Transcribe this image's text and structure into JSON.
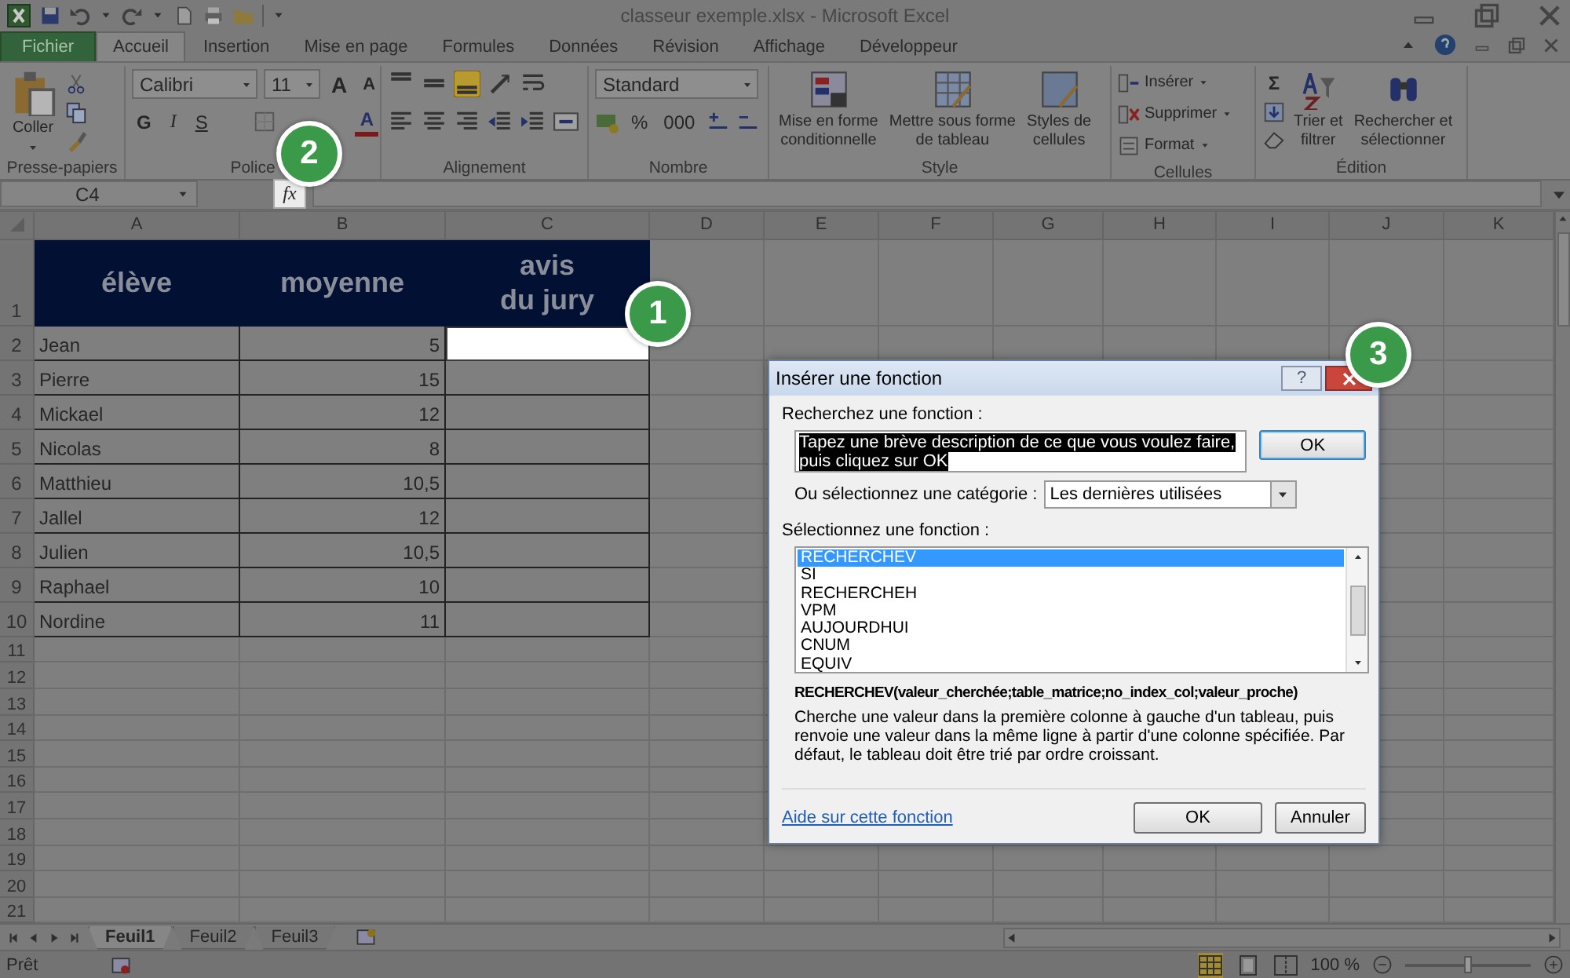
{
  "window": {
    "title": "classeur exemple.xlsx - Microsoft Excel"
  },
  "ribbon_tabs": [
    {
      "label": "Fichier",
      "kind": "file",
      "selected": false
    },
    {
      "label": "Accueil",
      "kind": "tab",
      "selected": true
    },
    {
      "label": "Insertion",
      "kind": "tab",
      "selected": false
    },
    {
      "label": "Mise en page",
      "kind": "tab",
      "selected": false
    },
    {
      "label": "Formules",
      "kind": "tab",
      "selected": false
    },
    {
      "label": "Données",
      "kind": "tab",
      "selected": false
    },
    {
      "label": "Révision",
      "kind": "tab",
      "selected": false
    },
    {
      "label": "Affichage",
      "kind": "tab",
      "selected": false
    },
    {
      "label": "Développeur",
      "kind": "tab",
      "selected": false
    }
  ],
  "ribbon": {
    "clipboard": {
      "label": "Presse-papiers",
      "paste": "Coller"
    },
    "font": {
      "label": "Police",
      "font_name": "Calibri",
      "font_size": "11",
      "grow": "A",
      "shrink": "A",
      "bold": "G",
      "italic": "I",
      "underline": "S",
      "font_color": "A"
    },
    "alignment": {
      "label": "Alignement",
      "buttons": [
        {
          "kind": "top",
          "on": false
        },
        {
          "kind": "middle",
          "on": false
        },
        {
          "kind": "bottom",
          "on": true
        },
        {
          "kind": "orientation",
          "on": false
        },
        {
          "kind": "wrap",
          "on": false
        },
        {
          "kind": "left",
          "on": false
        },
        {
          "kind": "center",
          "on": false
        },
        {
          "kind": "right",
          "on": false
        },
        {
          "kind": "outdent",
          "on": false
        },
        {
          "kind": "indent",
          "on": false
        },
        {
          "kind": "merge",
          "on": false
        }
      ]
    },
    "number": {
      "label": "Nombre",
      "format": "Standard",
      "percent": "%",
      "thousands": "000"
    },
    "styles": {
      "label": "Style",
      "buttons": [
        "Mise en forme\nconditionnelle",
        "Mettre sous forme\nde tableau",
        "Styles de\ncellules"
      ]
    },
    "cells": {
      "label": "Cellules",
      "buttons": [
        "Insérer",
        "Supprimer",
        "Format"
      ]
    },
    "editing": {
      "label": "Édition",
      "sum": "Σ",
      "buttons": [
        "Trier et\nfiltrer",
        "Rechercher et\nsélectionner"
      ]
    }
  },
  "formula_bar": {
    "name_box": "C4",
    "function_button": "fx"
  },
  "sheet": {
    "columns": [
      "A",
      "B",
      "C",
      "D",
      "E",
      "F",
      "G",
      "H",
      "I",
      "J",
      "K"
    ],
    "header_row": {
      "number": "1",
      "cells": [
        "élève",
        "moyenne",
        "avis\ndu jury"
      ]
    },
    "rows": [
      {
        "number": "2",
        "student": "Jean",
        "average": "5",
        "selected": true
      },
      {
        "number": "3",
        "student": "Pierre",
        "average": "15",
        "selected": false
      },
      {
        "number": "4",
        "student": "Mickael",
        "average": "12",
        "selected": false
      },
      {
        "number": "5",
        "student": "Nicolas",
        "average": "8",
        "selected": false
      },
      {
        "number": "6",
        "student": "Matthieu",
        "average": "10,5",
        "selected": false
      },
      {
        "number": "7",
        "student": "Jallel",
        "average": "12",
        "selected": false
      },
      {
        "number": "8",
        "student": "Julien",
        "average": "10,5",
        "selected": false
      },
      {
        "number": "9",
        "student": "Raphael",
        "average": "10",
        "selected": false
      },
      {
        "number": "10",
        "student": "Nordine",
        "average": "11",
        "selected": false
      }
    ],
    "empty_rows": [
      "11",
      "12",
      "13",
      "14",
      "15",
      "16",
      "17",
      "18",
      "19",
      "20",
      "21"
    ]
  },
  "sheet_tabs": [
    {
      "label": "Feuil1",
      "selected": true
    },
    {
      "label": "Feuil2",
      "selected": false
    },
    {
      "label": "Feuil3",
      "selected": false
    }
  ],
  "status_bar": {
    "status": "Prêt",
    "zoom": "100 %",
    "zoom_slider": {
      "level": 0.5
    }
  },
  "dialog": {
    "title": "Insérer une fonction",
    "help_button": "?",
    "search_label": "Recherchez une fonction :",
    "search_value": "Tapez une brève description de ce que vous voulez faire, puis cliquez sur OK",
    "search_value_selected": true,
    "search_button": "OK",
    "category_label": "Ou sélectionnez une catégorie :",
    "category_value": "Les dernières utilisées",
    "function_label": "Sélectionnez une fonction :",
    "functions": [
      {
        "name": "RECHERCHEV",
        "selected": true
      },
      {
        "name": "SI",
        "selected": false
      },
      {
        "name": "RECHERCHEH",
        "selected": false
      },
      {
        "name": "VPM",
        "selected": false
      },
      {
        "name": "AUJOURDHUI",
        "selected": false
      },
      {
        "name": "CNUM",
        "selected": false
      },
      {
        "name": "EQUIV",
        "selected": false
      }
    ],
    "syntax": "RECHERCHEV(valeur_cherchée;table_matrice;no_index_col;valeur_proche)",
    "description": "Cherche une valeur dans la première colonne à gauche d'un tableau, puis renvoie une valeur dans la même ligne à partir d'une colonne spécifiée. Par défaut, le tableau doit être trié par ordre croissant.",
    "help_link": "Aide sur cette fonction",
    "buttons": [
      "OK",
      "Annuler"
    ]
  },
  "callouts": [
    "1",
    "2",
    "3"
  ]
}
